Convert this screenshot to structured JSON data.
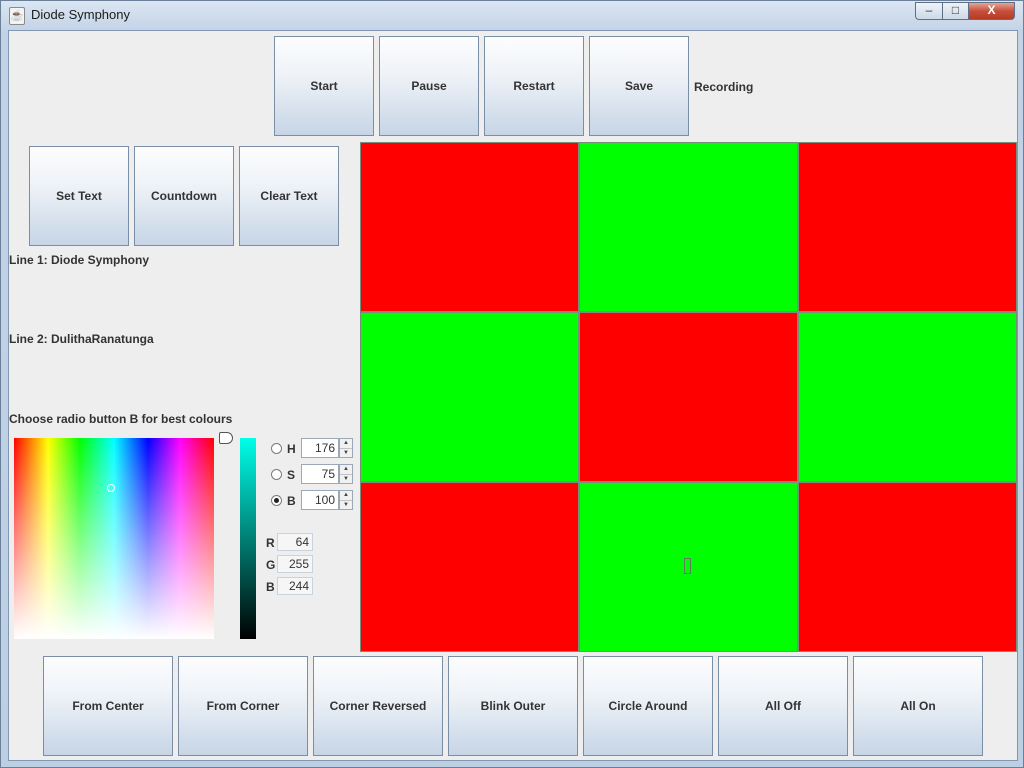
{
  "window": {
    "title": "Diode Symphony",
    "app_icon_glyph": "☕",
    "minimize_glyph": "–",
    "maximize_glyph": "□",
    "close_glyph": "X"
  },
  "recording_bar": {
    "start_label": "Start",
    "pause_label": "Pause",
    "restart_label": "Restart",
    "save_label": "Save",
    "status_label": "Recording"
  },
  "text_controls": {
    "set_text_label": "Set Text",
    "countdown_label": "Countdown",
    "clear_text_label": "Clear Text",
    "line1": "Line 1: Diode Symphony",
    "line2": "Line 2: DulithaRanatunga",
    "hint": "Choose radio button B for best colours"
  },
  "color_chooser": {
    "selected_mode": "B",
    "selected_color": "#40fff4",
    "h_label": "H",
    "h_value": "176",
    "s_label": "S",
    "s_value": "75",
    "b_label": "B",
    "b_value": "100",
    "r_label": "R",
    "r_value": "64",
    "g_label": "G",
    "g_value": "255",
    "b2_label": "B",
    "b2_value": "244"
  },
  "led_grid": {
    "rows": 3,
    "cols": 3,
    "on_color": "#00ff00",
    "off_color": "#ff0000",
    "cells": [
      "red",
      "green",
      "red",
      "green",
      "red",
      "green",
      "red",
      "green",
      "red"
    ]
  },
  "pattern_bar": {
    "from_center_label": "From Center",
    "from_corner_label": "From Corner",
    "corner_reversed_label": "Corner Reversed",
    "blink_outer_label": "Blink Outer",
    "circle_around_label": "Circle Around",
    "all_off_label": "All Off",
    "all_on_label": "All On"
  }
}
